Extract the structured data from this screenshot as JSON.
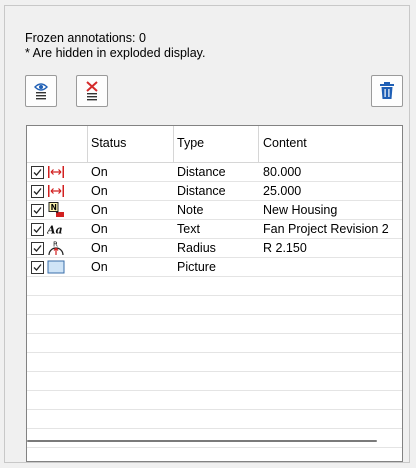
{
  "info": {
    "frozen_label": "Frozen annotations: 0",
    "hidden_note": "* Are hidden in exploded display."
  },
  "toolbar": {
    "show_icon": "eye-list-icon",
    "hide_icon": "hide-list-icon",
    "delete_icon": "trash-icon"
  },
  "table": {
    "columns": [
      "Status",
      "Type",
      "Content"
    ],
    "rows": [
      {
        "checked": true,
        "icon": "distance-icon",
        "status": "On",
        "type": "Distance",
        "content": "80.000"
      },
      {
        "checked": true,
        "icon": "distance-icon",
        "status": "On",
        "type": "Distance",
        "content": "25.000"
      },
      {
        "checked": true,
        "icon": "note-icon",
        "status": "On",
        "type": "Note",
        "content": "New Housing"
      },
      {
        "checked": true,
        "icon": "text-icon",
        "status": "On",
        "type": "Text",
        "content": "Fan Project Revision 2"
      },
      {
        "checked": true,
        "icon": "radius-icon",
        "status": "On",
        "type": "Radius",
        "content": "R 2.150"
      },
      {
        "checked": true,
        "icon": "picture-icon",
        "status": "On",
        "type": "Picture",
        "content": ""
      }
    ],
    "note_icon_letter": "N",
    "text_icon_glyph": "Aa",
    "radius_icon_letter": "R"
  },
  "colors": {
    "accent_blue": "#1f5fb5",
    "distance_red": "#d22020",
    "delete_red": "#d42a2a"
  }
}
